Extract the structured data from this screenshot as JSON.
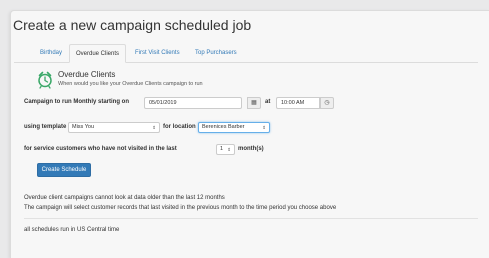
{
  "page": {
    "title": "Create a new campaign scheduled job"
  },
  "tabs": [
    {
      "label": "Birthday",
      "active": false
    },
    {
      "label": "Overdue Clients",
      "active": true
    },
    {
      "label": "First Visit Clients",
      "active": false
    },
    {
      "label": "Top Purchasers",
      "active": false
    }
  ],
  "section": {
    "icon": "alarm-clock-icon",
    "title": "Overdue Clients",
    "subtitle": "When would you like your Overdue Clients campaign to run"
  },
  "schedule": {
    "label": "Campaign to run Monthly starting on",
    "date_value": "05/01/2019",
    "calendar_icon": "calendar-icon",
    "at_label": "at",
    "time_value": "10:00 AM",
    "time_icon": "clock-icon"
  },
  "template_row": {
    "template_label": "using template",
    "template_value": "Miss You",
    "location_label": "for location",
    "location_value": "Berenices Barber"
  },
  "visit_row": {
    "prefix": "for service customers who have not visited in the last",
    "months_value": "1",
    "suffix": "month(s)"
  },
  "buttons": {
    "create_schedule": "Create Schedule"
  },
  "notes": {
    "line1": "Overdue client campaigns cannot look at data older than the last 12 months",
    "line2": "The campaign will select customer records that last visited in the previous month to the time period you choose above"
  },
  "footer": {
    "timezone_note": "all schedules run in US Central time"
  },
  "colors": {
    "accent": "#337ab7",
    "clock_icon": "#3aa868"
  }
}
